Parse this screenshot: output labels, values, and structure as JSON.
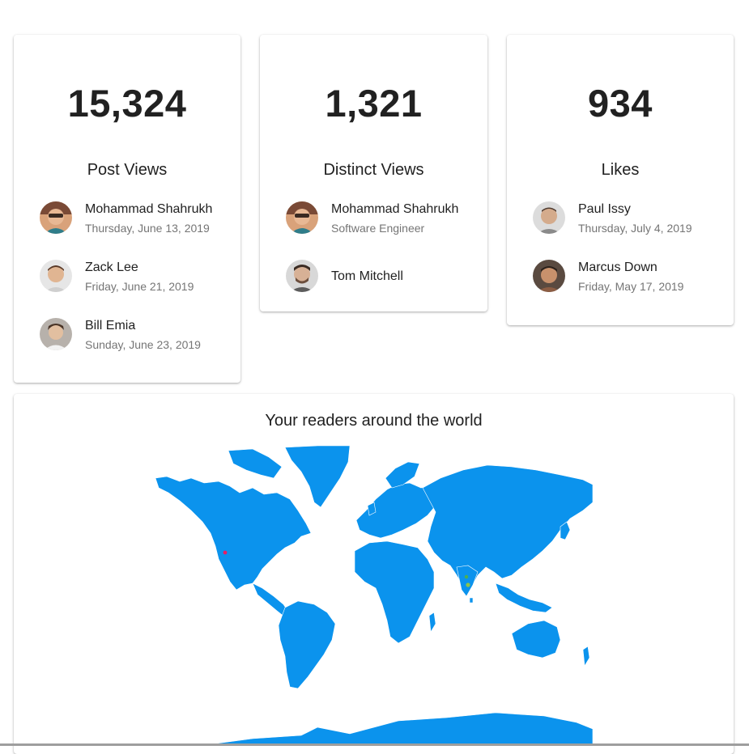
{
  "stats": [
    {
      "value": "15,324",
      "label": "Post Views",
      "people": [
        {
          "name": "Mohammad Shahrukh",
          "sub": "Thursday, June 13, 2019",
          "avatar": "avatar-shahrukh"
        },
        {
          "name": "Zack Lee",
          "sub": "Friday, June 21, 2019",
          "avatar": "avatar-zack"
        },
        {
          "name": "Bill Emia",
          "sub": "Sunday, June 23, 2019",
          "avatar": "avatar-bill"
        }
      ]
    },
    {
      "value": "1,321",
      "label": "Distinct Views",
      "people": [
        {
          "name": "Mohammad Shahrukh",
          "sub": "Software Engineer",
          "avatar": "avatar-shahrukh"
        },
        {
          "name": "Tom Mitchell",
          "sub": "",
          "avatar": "avatar-tom"
        }
      ]
    },
    {
      "value": "934",
      "label": "Likes",
      "people": [
        {
          "name": "Paul Issy",
          "sub": "Thursday, July 4, 2019",
          "avatar": "avatar-paul"
        },
        {
          "name": "Marcus Down",
          "sub": "Friday, May 17, 2019",
          "avatar": "avatar-marcus"
        }
      ]
    }
  ],
  "map": {
    "title": "Your readers around the world",
    "land_color": "#0b93ed",
    "border_color": "#ffffff",
    "markers": [
      {
        "name": "marker-usa-west",
        "color": "#e91e63"
      },
      {
        "name": "marker-india-north",
        "color": "#4caf50"
      },
      {
        "name": "marker-india-south",
        "color": "#8bc34a"
      }
    ]
  }
}
